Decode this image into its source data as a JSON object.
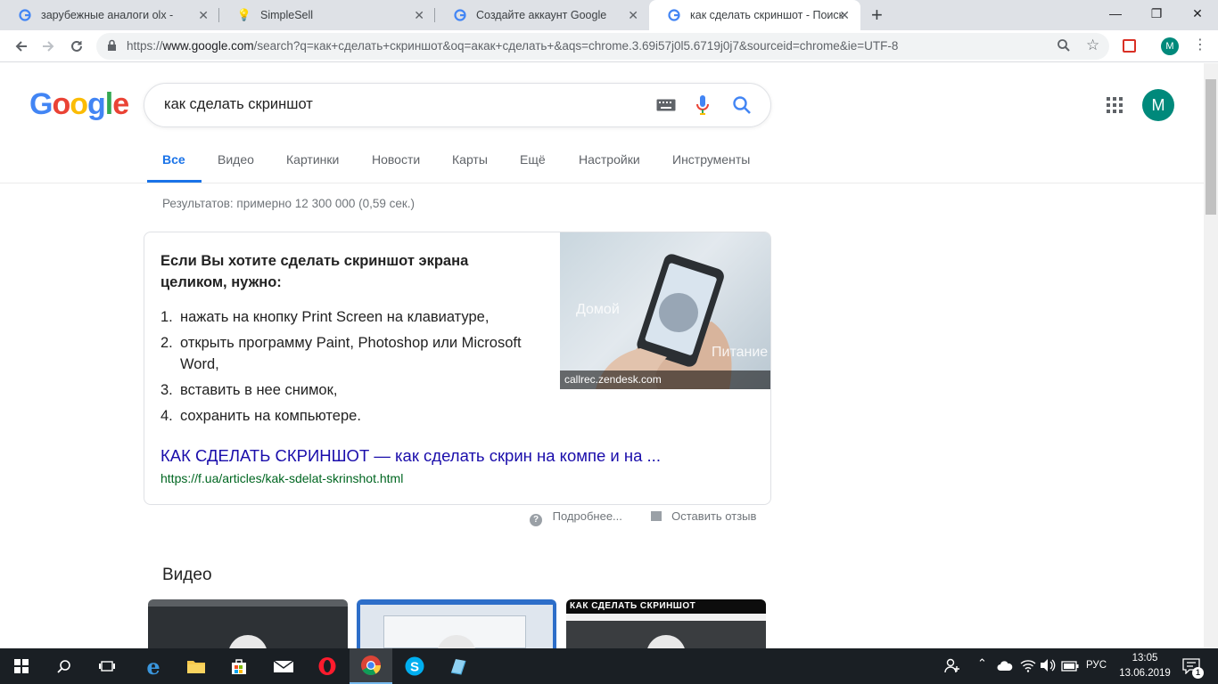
{
  "browser": {
    "tabs": [
      {
        "title": "зарубежные аналоги olx - Поиск",
        "active": false
      },
      {
        "title": "SimpleSell",
        "active": false
      },
      {
        "title": "Создайте аккаунт Google",
        "active": false
      },
      {
        "title": "как сделать скриншот - Поиск в",
        "active": true
      }
    ],
    "new_tab": "+",
    "url_prefix": "https://",
    "url_domain": "www.google.com",
    "url_rest": "/search?q=как+сделать+скриншот&oq=акак+сделать+&aqs=chrome.3.69i57j0l5.6719j0j7&sourceid=chrome&ie=UTF-8",
    "profile_initial": "M"
  },
  "google": {
    "logo": [
      "G",
      "o",
      "o",
      "g",
      "l",
      "e"
    ],
    "logo_colors": [
      "#4285F4",
      "#EA4335",
      "#FBBC05",
      "#4285F4",
      "#34A853",
      "#EA4335"
    ],
    "query": "как сделать скриншот",
    "avatar_initial": "M",
    "nav_tabs": [
      "Все",
      "Видео",
      "Картинки",
      "Новости",
      "Карты",
      "Ещё",
      "Настройки",
      "Инструменты"
    ],
    "stats": "Результатов: примерно 12 300 000 (0,59 сек.)"
  },
  "snippet": {
    "heading": "Если Вы хотите сделать скриншот экрана целиком, нужно:",
    "steps": [
      {
        "n": "1.",
        "text": "нажать на кнопку Print Screen на клавиатуре,"
      },
      {
        "n": "2.",
        "text": "открыть программу Paint, Photoshop или Microsoft Word,"
      },
      {
        "n": "3.",
        "text": "вставить в нее снимок,"
      },
      {
        "n": "4.",
        "text": "сохранить на компьютере."
      }
    ],
    "image_caption": "callrec.zendesk.com",
    "image_label_1": "Домой",
    "image_label_2": "Питание",
    "link_title": "КАК СДЕЛАТЬ СКРИНШОТ — как сделать скрин на компе и на ...",
    "link_url": "https://f.ua/articles/kak-sdelat-skrinshot.html"
  },
  "feedback": {
    "more": "Подробнее...",
    "report": "Оставить отзыв"
  },
  "videos": {
    "heading": "Видео",
    "thumb3_text": "КАК СДЕЛАТЬ СКРИНШОТ"
  },
  "taskbar": {
    "lang": "РУС",
    "time": "13:05",
    "date": "13.06.2019",
    "notification_count": "1"
  }
}
